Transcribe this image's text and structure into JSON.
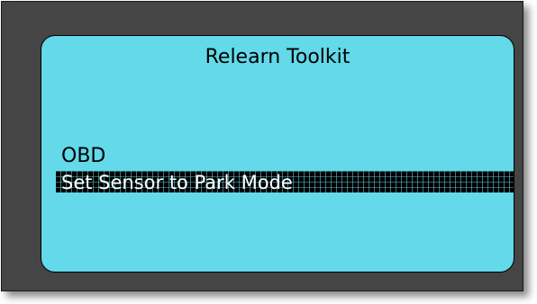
{
  "screen": {
    "title": "Relearn Toolkit",
    "section_label": "OBD",
    "selected_item": "Set Sensor to Park Mode"
  },
  "colors": {
    "bezel": "#454545",
    "screen": "#63d9e9",
    "selection": "#000000",
    "selection_text": "#ffffff"
  }
}
